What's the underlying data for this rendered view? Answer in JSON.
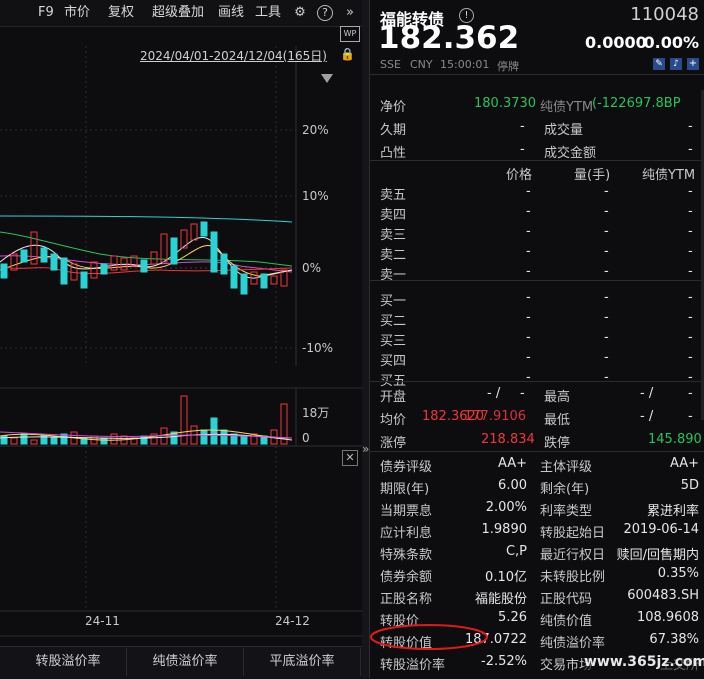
{
  "toolbar": {
    "f9": "F9",
    "market_price": "市价",
    "restore_rights": "复权",
    "super_overlay": "超级叠加",
    "draw_line": "画线",
    "tools": "工具"
  },
  "chart": {
    "date_range": "2024/04/01-2024/12/04(165日)",
    "pct_labels": [
      "20%",
      "10%",
      "0%",
      "-10%"
    ],
    "volume_labels": [
      "18万",
      "0"
    ],
    "x_labels": [
      "24-11",
      "24-12"
    ],
    "close_icon_label": "✕"
  },
  "bottom_tabs": [
    "转股溢价率",
    "纯债溢价率",
    "平底溢价率"
  ],
  "quote": {
    "name": "福能转债",
    "code": "110048",
    "price": "182.362",
    "change": "0.0000",
    "change_pct": "0.00%",
    "exchange": "SSE",
    "currency": "CNY",
    "time": "15:00:01",
    "status": "停牌"
  },
  "stats1": {
    "net_price_label": "净价",
    "net_price_value": "180.3730",
    "ytm_label": "纯债YTM",
    "ytm_value": "(-122697.8BP",
    "duration_label": "久期",
    "duration_value": "-",
    "volume_label": "成交量",
    "volume_value": "-",
    "convexity_label": "凸性",
    "convexity_value": "-",
    "amount_label": "成交金额",
    "amount_value": "-"
  },
  "orderbook": {
    "headers": [
      "价格",
      "量(手)",
      "纯债YTM"
    ],
    "sell": [
      "卖五",
      "卖四",
      "卖三",
      "卖二",
      "卖一"
    ],
    "buy": [
      "买一",
      "买二",
      "买三",
      "买四",
      "买五"
    ],
    "dash": "-"
  },
  "stats2": {
    "open_label": "开盘",
    "open_value": "- /",
    "open_dash": "-",
    "high_label": "最高",
    "high_value": "- /",
    "high_dash": "-",
    "avg_label": "均价",
    "avg_value1": "182.3620",
    "avg_value2": "177.9106",
    "low_label": "最低",
    "low_value": "- /",
    "low_dash": "-",
    "limit_up_label": "涨停",
    "limit_up_value": "218.834",
    "limit_down_label": "跌停",
    "limit_down_value": "145.890"
  },
  "bondinfo": [
    {
      "l1": "债券评级",
      "v1": "AA+",
      "l2": "主体评级",
      "v2": "AA+"
    },
    {
      "l1": "期限(年)",
      "v1": "6.00",
      "l2": "剩余(年)",
      "v2": "5D"
    },
    {
      "l1": "当期票息",
      "v1": "2.00%",
      "l2": "利率类型",
      "v2": "累进利率"
    },
    {
      "l1": "应计利息",
      "v1": "1.9890",
      "l2": "转股起始日",
      "v2": "2019-06-14"
    },
    {
      "l1": "特殊条款",
      "v1": "C,P",
      "l2": "最近行权日",
      "v2": "赎回/回售期内"
    },
    {
      "l1": "债券余额",
      "v1": "0.10亿",
      "l2": "未转股比例",
      "v2": "0.35%"
    },
    {
      "l1": "正股名称",
      "v1": "福能股份",
      "l2": "正股代码",
      "v2": "600483.SH"
    },
    {
      "l1": "转股价",
      "v1": "5.26",
      "l2": "纯债价值",
      "v2": "108.9608"
    },
    {
      "l1": "转股价值",
      "v1": "187.0722",
      "l2": "纯债溢价率",
      "v2": "67.38%"
    },
    {
      "l1": "转股溢价率",
      "v1": "-2.52%",
      "l2": "交易市场",
      "v2": "上交所"
    }
  ],
  "watermark": "www.365jz.com",
  "colors": {
    "up": "#f0363c",
    "down": "#25c45a",
    "cyan": "#2ad3d3",
    "yellow": "#ffd84a",
    "magenta": "#d64ad6",
    "white_ma": "#e8e8e8"
  }
}
